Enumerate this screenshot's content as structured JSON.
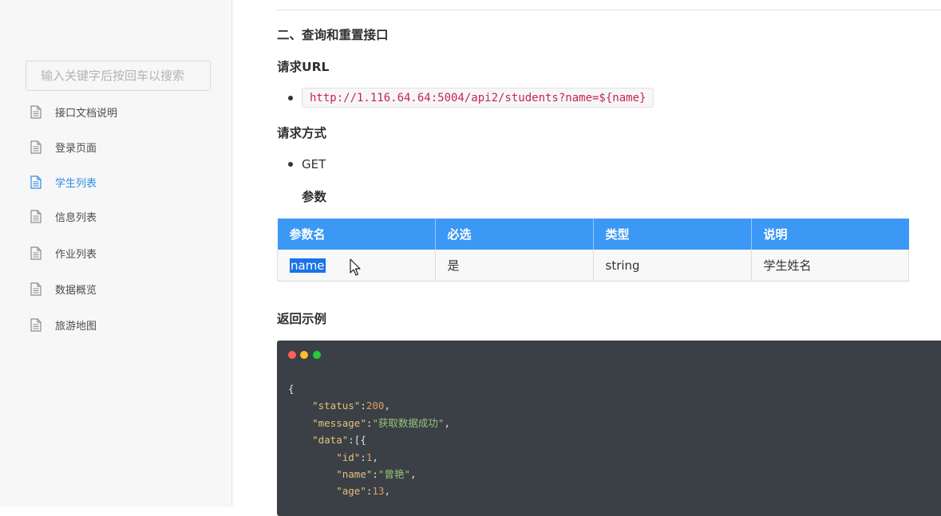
{
  "sidebar": {
    "search_placeholder": "输入关键字后按回车以搜索",
    "items": [
      {
        "label": "接口文档说明",
        "active": false
      },
      {
        "label": "登录页面",
        "active": false
      },
      {
        "label": "学生列表",
        "active": true
      },
      {
        "label": "信息列表",
        "active": false
      },
      {
        "label": "作业列表",
        "active": false
      },
      {
        "label": "数据概览",
        "active": false
      },
      {
        "label": "旅游地图",
        "active": false
      }
    ]
  },
  "content": {
    "section_title": "二、查询和重置接口",
    "url_heading": "请求URL",
    "url": "http://1.116.64.64:5004/api2/students?name=${name}",
    "method_heading": "请求方式",
    "method": "GET",
    "params_heading": "参数",
    "params_table": {
      "headers": [
        "参数名",
        "必选",
        "类型",
        "说明"
      ],
      "rows": [
        {
          "name": "name",
          "required": "是",
          "type": "string",
          "desc": "学生姓名"
        }
      ]
    },
    "return_heading": "返回示例",
    "code_lines": [
      "{",
      "\"status\":200,",
      "\"message\":\"获取数据成功\",",
      "\"data\":[{",
      "\"id\":1,",
      "\"name\":\"曾艳\",",
      "\"age\":13,"
    ]
  },
  "colors": {
    "accent": "#3b98f5",
    "active_nav": "#2b8de3",
    "code_bg": "#3a4045",
    "url_text": "#c7254e",
    "dot_red": "#ff5f56",
    "dot_yellow": "#ffbd2e",
    "dot_green": "#27c93f"
  },
  "icons": {
    "nav_item": "document-icon",
    "pointer": "mouse-cursor-icon"
  }
}
